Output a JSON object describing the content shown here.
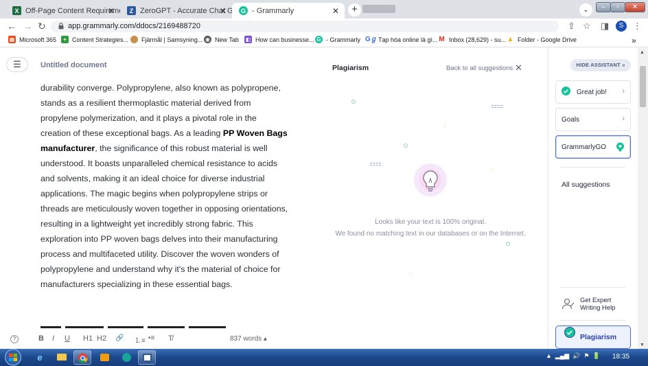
{
  "browser": {
    "tabs": [
      {
        "label": "Off-Page Content Requirement S",
        "icon": "excel-icon",
        "color": "#1d6f42",
        "glyph": "X"
      },
      {
        "label": "ZeroGPT - Accurate Chat GPT, GP",
        "icon": "zerogpt-icon",
        "color": "#2c5aa0",
        "glyph": "Z"
      },
      {
        "label": "- Grammarly",
        "icon": "grammarly-icon",
        "color": "#15c39a",
        "glyph": "G"
      }
    ],
    "url": "app.grammarly.com/ddocs/2169488720",
    "profile_initial": "S",
    "bookmarks": [
      {
        "label": "Microsoft 365",
        "icon": "microsoft-icon",
        "color": "#e74c1c",
        "glyph": "▦"
      },
      {
        "label": "Content Strategies...",
        "icon": "content-strategies-icon",
        "color": "#2e9a3f",
        "glyph": "+"
      },
      {
        "label": "Fjärmål | Samsyning...",
        "icon": "fjarmal-icon",
        "color": "#c9904c",
        "glyph": "●"
      },
      {
        "label": "New Tab",
        "icon": "globe-icon",
        "color": "#555555",
        "glyph": "◉"
      },
      {
        "label": "How can businesse...",
        "icon": "bookmark-page-icon",
        "color": "#7b4fd1",
        "glyph": "◧"
      },
      {
        "label": "- Grammarly",
        "icon": "grammarly-icon",
        "color": "#15c39a",
        "glyph": "G"
      },
      {
        "label": "Tạp hóa online là gì...",
        "icon": "gg-icon",
        "color": "#ffffff",
        "glyph": "Gℊ"
      },
      {
        "label": "Inbox (28,629) - su...",
        "icon": "gmail-icon",
        "color": "#ffffff",
        "glyph": "M"
      },
      {
        "label": "Folder - Google Drive",
        "icon": "google-drive-icon",
        "color": "#ffffff",
        "glyph": "▲"
      }
    ],
    "more_bookmarks": "»"
  },
  "editor": {
    "doc_title": "Untitled document",
    "paragraph": [
      {
        "text": "durability converge. Polypropylene, also known as polypropene, stands as a resilient thermoplastic material derived from propylene polymerization, and it plays a pivotal role in the creation of these exceptional bags. As a leading ",
        "bold": false
      },
      {
        "text": "PP Woven Bags manufacturer",
        "bold": true
      },
      {
        "text": ", the significance of this robust material is well understood. It boasts unparalleled chemical resistance to acids and solvents, making it an ideal choice for diverse industrial applications. The magic begins when polypropylene strips or threads are meticulously woven together in opposing orientations, resulting in a lightweight yet incredibly strong fabric. This exploration into PP woven bags delves into their manufacturing process and multifaceted utility. Discover the woven wonders of polypropylene and understand why it's the material of choice for manufacturers specializing in these essential bags.",
        "bold": false
      }
    ],
    "toolbar": {
      "help": "?",
      "bold": "B",
      "italic": "I",
      "underline": "U",
      "h1": "H1",
      "h2": "H2",
      "link": "🔗",
      "ordered_list": "⒈≡",
      "bullet_list": "•≡",
      "clear_format": "T̸"
    },
    "word_count": "837 words ▴"
  },
  "plagiarism": {
    "title": "Plagiarism",
    "back_link": "Back to all suggestions",
    "close": "✕",
    "message_line1": "Looks like your text is 100% original.",
    "message_line2": "We found no matching text in our databases or on the Internet."
  },
  "assistant": {
    "hide_label": "HIDE ASSISTANT",
    "hide_chevron": "»",
    "cards": [
      {
        "label": "Great job!",
        "chevron": "›"
      },
      {
        "label": "Goals",
        "chevron": "›"
      },
      {
        "label": "GrammarlyGO",
        "chevron": ""
      }
    ],
    "all_suggestions": "All suggestions",
    "expert_line1": "Get Expert",
    "expert_line2": "Writing Help",
    "plagiarism_button": "Plagiarism"
  },
  "taskbar": {
    "clock": "18:35",
    "apps": [
      "ie-icon",
      "explorer-icon",
      "chrome-icon",
      "media-player-icon",
      "edge-icon",
      "word-icon"
    ]
  },
  "colors": {
    "grammarly_green": "#15c39a",
    "accent_blue": "#4a6ee0",
    "taskbar_blue": "#1d4a8f"
  }
}
